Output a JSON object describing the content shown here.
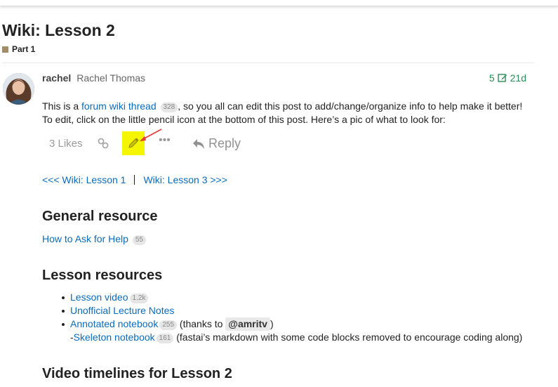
{
  "page": {
    "title": "Wiki: Lesson 2",
    "category": "Part 1",
    "colors": {
      "category": "#a38d69",
      "link": "#0a6bbd",
      "meta": "#2e8b57",
      "highlight": "#f5f500"
    }
  },
  "post": {
    "username": "rachel",
    "full_name": "Rachel Thomas",
    "edit_count": "5",
    "age": "21d",
    "intro_before_link": "This is a ",
    "wiki_link": "forum wiki thread",
    "wiki_link_count": "328",
    "intro_after_link": ", so you all can edit this post to add/change/organize info to help make it better!",
    "intro_line2": "To edit, click on the little pencil icon at the bottom of this post. Here’s a pic of what to look for:"
  },
  "actions": {
    "likes": "3 Likes",
    "reply": "Reply",
    "more": "•••",
    "icons": [
      "link-icon",
      "pencil-icon",
      "more-icon",
      "reply-icon"
    ]
  },
  "nav": {
    "prev": "<<< Wiki: Lesson 1",
    "next": "Wiki: Lesson 3 >>>"
  },
  "general": {
    "heading": "General resource",
    "link": "How to Ask for Help",
    "count": "55"
  },
  "lesson_resources": {
    "heading": "Lesson resources",
    "video": {
      "label": "Lesson video",
      "count": "1.2k"
    },
    "notes": {
      "label": "Unofficial Lecture Notes"
    },
    "annotated": {
      "label": "Annotated notebook",
      "count": "255",
      "pre": "(thanks to",
      "mention": "@amritv",
      "post": ")"
    },
    "skeleton": {
      "prefix": "-",
      "label": "Skeleton notebook",
      "count": "161",
      "desc": "(fastai’s markdown with some code blocks removed to encourage coding along)"
    }
  },
  "video_timelines": {
    "heading": "Video timelines for Lesson 2"
  }
}
